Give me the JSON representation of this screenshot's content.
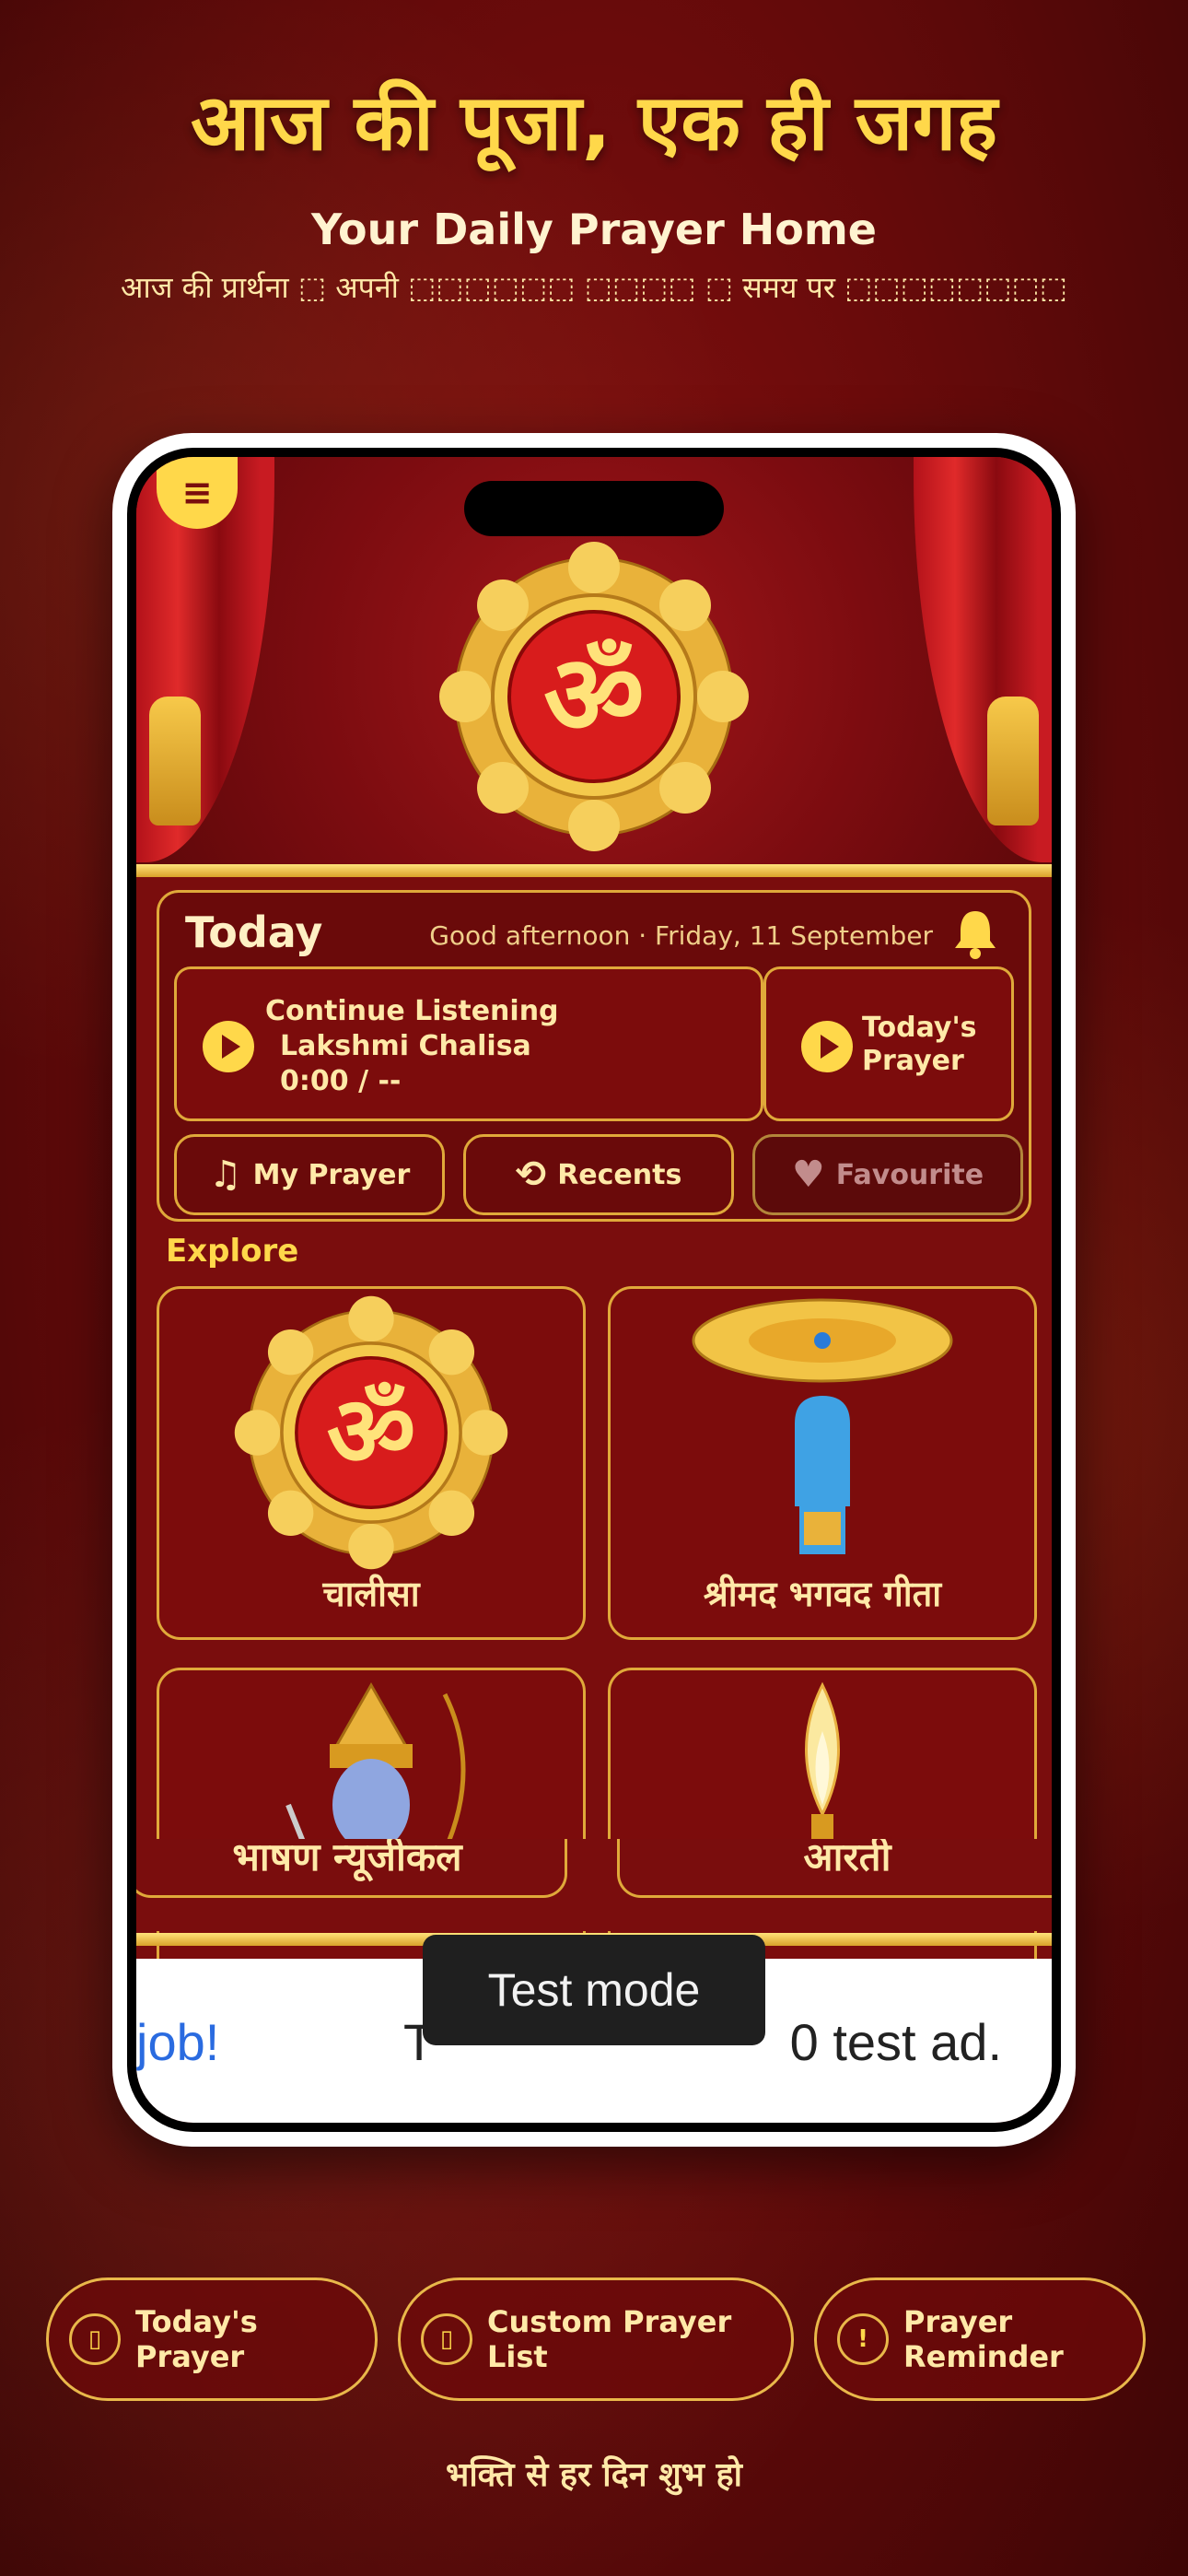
{
  "header": {
    "headline": "आज की पूजा, एक ही जगह",
    "subhead": "Your Daily Prayer Home",
    "tagline": "आज की प्रार्थना ⬚ अपनी ⬚⬚⬚⬚⬚⬚ ⬚⬚⬚⬚ ⬚ समय पर ⬚⬚⬚⬚⬚⬚⬚⬚"
  },
  "app": {
    "menu_icon": "menu-icon",
    "today": {
      "title": "Today",
      "greeting": "Good afternoon · Friday, 11 September",
      "bell_icon": "bell-icon",
      "continue": {
        "label": "Continue Listening",
        "track": "Lakshmi Chalisa",
        "time": "0:00 / --"
      },
      "todays_prayer": {
        "line1": "Today's",
        "line2": "Prayer"
      },
      "pills": [
        {
          "label": "My Prayer",
          "icon": "music-list-icon"
        },
        {
          "label": "Recents",
          "icon": "history-icon"
        },
        {
          "label": "Favourite",
          "icon": "heart-icon"
        }
      ]
    },
    "explore": {
      "label": "Explore",
      "tiles": [
        {
          "label": "चालीसा",
          "icon": "om-emblem-icon"
        },
        {
          "label": "श्रीमद भगवद गीता",
          "icon": "sudarshan-chakra-icon"
        },
        {
          "label": "",
          "icon": "lord-rama-icon"
        },
        {
          "label": "",
          "icon": "diya-flame-icon"
        }
      ],
      "strip_labels": [
        "भाषण न्यूजीकल",
        "आरती"
      ]
    },
    "ad": {
      "left": "job!",
      "mid": "T",
      "right": "0 test ad."
    },
    "toast": "Test mode"
  },
  "chips": [
    {
      "label": "Today's Prayer",
      "icon": "box-icon",
      "glyph": "▯"
    },
    {
      "label": "Custom Prayer List",
      "icon": "box-icon",
      "glyph": "▯"
    },
    {
      "label": "Prayer Reminder",
      "icon": "exclamation-icon",
      "glyph": "!"
    }
  ],
  "footer": "भक्ति से हर दिन शुभ हो",
  "colors": {
    "gold": "#ffd84a",
    "maroon": "#7a0d0d",
    "border_gold": "#e0a93a"
  }
}
